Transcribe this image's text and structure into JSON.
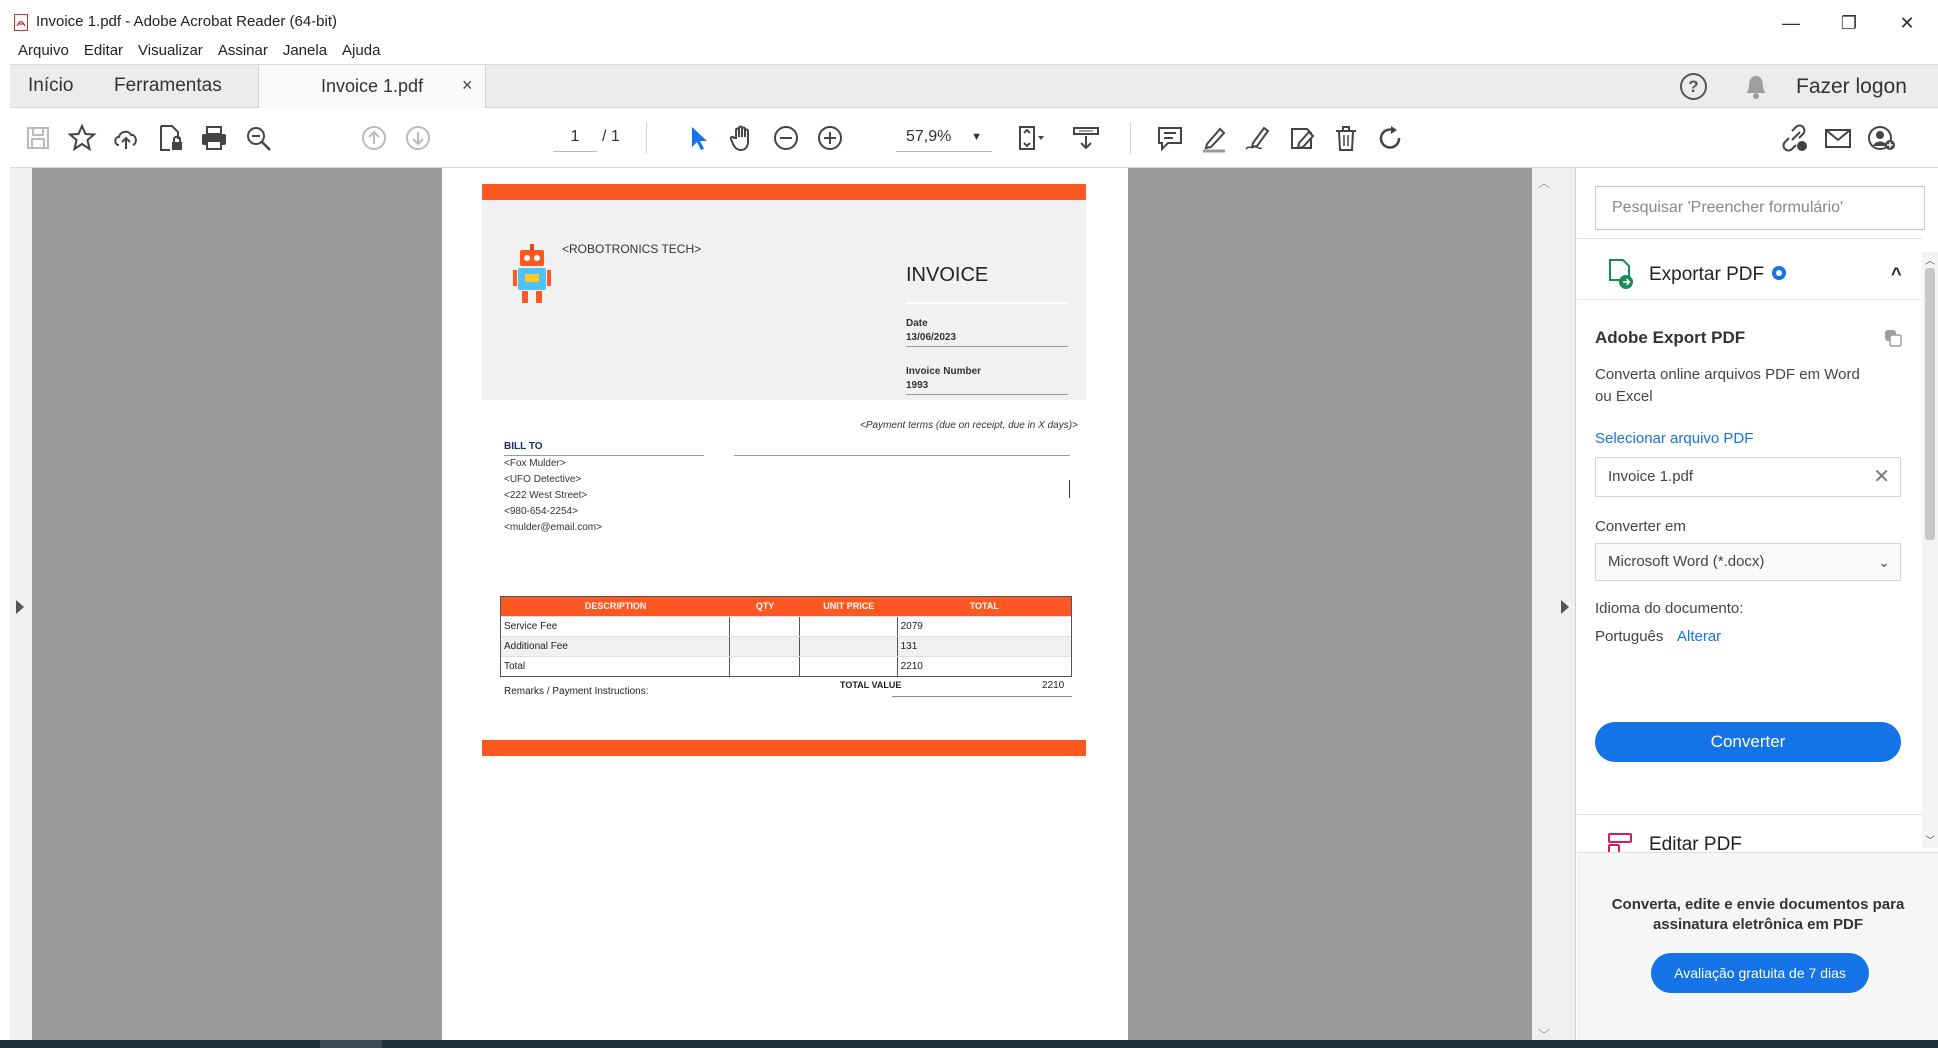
{
  "window": {
    "title": "Invoice 1.pdf - Adobe Acrobat Reader (64-bit)",
    "minimize": "—",
    "restore": "❐",
    "close": "✕"
  },
  "menu": [
    "Arquivo",
    "Editar",
    "Visualizar",
    "Assinar",
    "Janela",
    "Ajuda"
  ],
  "tabs": {
    "home": "Início",
    "tools": "Ferramentas",
    "document": "Invoice 1.pdf",
    "close": "×"
  },
  "header_right": {
    "help": "?",
    "login": "Fazer logon"
  },
  "toolbar": {
    "page_current": "1",
    "page_total": "/ 1",
    "zoom": "57,9%",
    "zoom_caret": "▼"
  },
  "invoice": {
    "company": "<ROBOTRONICS TECH>",
    "title": "INVOICE",
    "date_label": "Date",
    "date_value": "13/06/2023",
    "number_label": "Invoice Number",
    "number_value": "1993",
    "payment_terms": "<Payment terms (due on receipt, due in X days)>",
    "bill_to_label": "BILL TO",
    "bill_to": [
      "<Fox Mulder>",
      "<UFO Detective>",
      "<222 West Street>",
      "<980-654-2254>",
      "<mulder@email.com>"
    ],
    "columns": [
      "DESCRIPTION",
      "QTY",
      "UNIT PRICE",
      "TOTAL"
    ],
    "rows": [
      [
        "Service Fee",
        "",
        "",
        "2079"
      ],
      [
        "Additional Fee",
        "",
        "",
        "131"
      ],
      [
        "Total",
        "",
        "",
        "2210"
      ]
    ],
    "remarks": "Remarks / Payment Instructions:",
    "total_value_label": "TOTAL VALUE",
    "total_value": "2210"
  },
  "right_panel": {
    "search_placeholder": "Pesquisar 'Preencher formulário'",
    "export_title": "Exportar PDF",
    "export_chevron": "^",
    "adobe_export_title": "Adobe Export PDF",
    "adobe_export_desc": "Converta online arquivos PDF em Word ou Excel",
    "select_file": "Selecionar arquivo PDF",
    "file_name": "Invoice 1.pdf",
    "file_clear": "✕",
    "convert_to_label": "Converter em",
    "format": "Microsoft Word (*.docx)",
    "format_chevron": "⌄",
    "language_label": "Idioma do documento:",
    "language_value": "Português",
    "language_change": "Alterar",
    "convert_button": "Converter",
    "edit_title": "Editar PDF",
    "promo_text": "Converta, edite e envie documentos para assinatura eletrônica em PDF",
    "trial_button": "Avaliação gratuita de 7 dias"
  },
  "colors": {
    "accent": "#1473e6",
    "invoice_orange": "#ff5722",
    "viewer_bg": "#9b9b9b"
  }
}
